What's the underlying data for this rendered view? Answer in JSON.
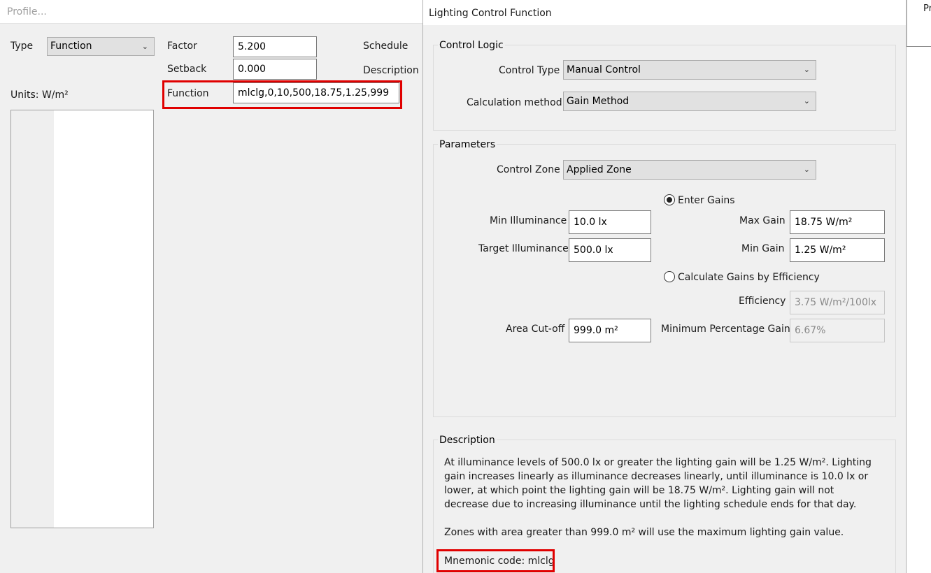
{
  "profile_window": {
    "title": "Profile...",
    "type_label": "Type",
    "type_value": "Function",
    "factor_label": "Factor",
    "factor_value": "5.200",
    "setback_label": "Setback",
    "setback_value": "0.000",
    "function_label": "Function",
    "function_value": "mlclg,0,10,500,18.75,1.25,999",
    "schedule_label": "Schedule",
    "description_label": "Description",
    "units_label": "Units: W/m²"
  },
  "right_edge": {
    "text": "Pr"
  },
  "dialog": {
    "title": "Lighting Control Function",
    "control_logic": {
      "group_title": "Control Logic",
      "control_type_label": "Control Type",
      "control_type_value": "Manual Control",
      "calc_method_label": "Calculation method",
      "calc_method_value": "Gain Method"
    },
    "parameters": {
      "group_title": "Parameters",
      "control_zone_label": "Control Zone",
      "control_zone_value": "Applied Zone",
      "enter_gains_label": "Enter Gains",
      "enter_gains_selected": true,
      "min_illuminance_label": "Min Illuminance",
      "min_illuminance_value": "10.0 lx",
      "target_illuminance_label": "Target Illuminance",
      "target_illuminance_value": "500.0 lx",
      "max_gain_label": "Max Gain",
      "max_gain_value": "18.75 W/m²",
      "min_gain_label": "Min Gain",
      "min_gain_value": "1.25 W/m²",
      "calc_by_efficiency_label": "Calculate Gains by Efficiency",
      "efficiency_label": "Efficiency",
      "efficiency_value": "3.75 W/m²/100lx",
      "area_cutoff_label": "Area Cut-off",
      "area_cutoff_value": "999.0 m²",
      "min_pct_gain_label": "Minimum Percentage Gain",
      "min_pct_gain_value": "6.67%"
    },
    "description": {
      "group_title": "Description",
      "line1": "At illuminance levels of 500.0 lx or greater the lighting gain will be 1.25 W/m². Lighting",
      "line2": "gain increases linearly as illuminance decreases linearly, until illuminance is 10.0 lx or",
      "line3": "lower, at which point the lighting gain will be 18.75 W/m². Lighting gain will not",
      "line4": "decrease due to increasing illuminance until the lighting schedule ends for that day.",
      "line5": "Zones with area greater than 999.0 m² will use the maximum lighting gain value.",
      "mnemonic": "Mnemonic code: mlclg"
    }
  },
  "colors": {
    "highlight_red": "#e00000",
    "window_bg": "#f0f0f0"
  }
}
